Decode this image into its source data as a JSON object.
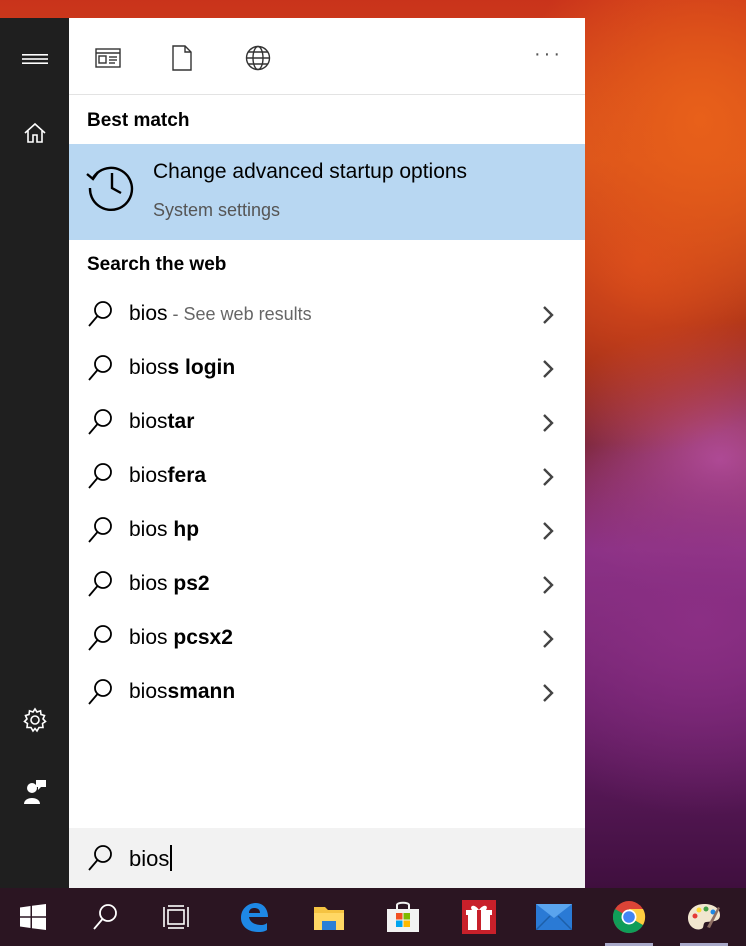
{
  "panel": {
    "tabs": [
      {
        "name": "apps-tab",
        "icon": "app-window-icon"
      },
      {
        "name": "documents-tab",
        "icon": "document-icon"
      },
      {
        "name": "web-tab",
        "icon": "globe-icon"
      }
    ],
    "more_label": "···",
    "best_match": {
      "heading": "Best match",
      "title": "Change advanced startup options",
      "subtitle": "System settings",
      "icon": "history-clock-icon"
    },
    "web": {
      "heading": "Search the web",
      "results": [
        {
          "prefix": "bios",
          "suffix": "",
          "hint": " - See web results"
        },
        {
          "prefix": "bios",
          "suffix": "s login",
          "hint": ""
        },
        {
          "prefix": "bios",
          "suffix": "tar",
          "hint": ""
        },
        {
          "prefix": "bios",
          "suffix": "fera",
          "hint": ""
        },
        {
          "prefix": "bios",
          "suffix": " hp",
          "hint": ""
        },
        {
          "prefix": "bios",
          "suffix": " ps2",
          "hint": ""
        },
        {
          "prefix": "bios",
          "suffix": " pcsx2",
          "hint": ""
        },
        {
          "prefix": "bios",
          "suffix": "smann",
          "hint": ""
        }
      ]
    }
  },
  "search": {
    "query": "bios"
  },
  "rail": {
    "items": [
      "hamburger-menu-icon",
      "home-icon",
      "settings-gear-icon",
      "user-feedback-icon"
    ]
  },
  "taskbar": {
    "items": [
      "windows-start-icon",
      "search-icon",
      "task-view-icon",
      "edge-browser-icon",
      "file-explorer-icon",
      "microsoft-store-icon",
      "gift-app-icon",
      "mail-icon",
      "chrome-icon",
      "paint-icon"
    ]
  },
  "colors": {
    "highlight": "#b8d7f2",
    "rail": "#1f1f1f",
    "taskbar": "#2b1522"
  }
}
